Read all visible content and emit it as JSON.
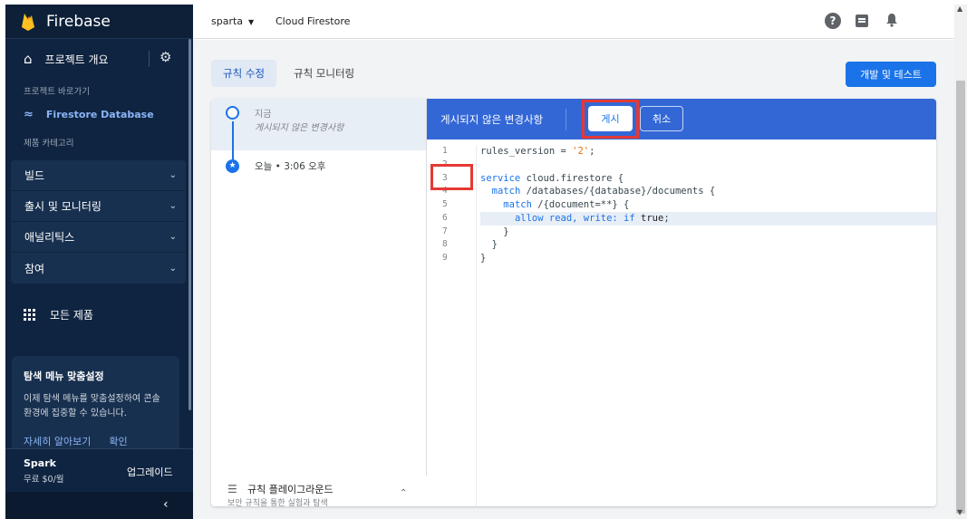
{
  "sidebar": {
    "brand": "Firebase",
    "overview_label": "프로젝트 개요",
    "shortcuts_label": "프로젝트 바로가기",
    "active_item": "Firestore Database",
    "category_label": "제품 카테고리",
    "groups": [
      {
        "label": "빌드"
      },
      {
        "label": "출시 및 모니터링"
      },
      {
        "label": "애널리틱스"
      },
      {
        "label": "참여"
      }
    ],
    "all_products": "모든 제품",
    "card": {
      "title": "탐색 메뉴 맞춤설정",
      "text": "이제 탐색 메뉴를 맞춤설정하여 콘솔 환경에 집중할 수 있습니다.",
      "learn_more": "자세히 알아보기",
      "confirm": "확인"
    },
    "plan": {
      "name": "Spark",
      "price": "무료 $0/월",
      "upgrade": "업그레이드"
    }
  },
  "topbar": {
    "project": "sparta",
    "product": "Cloud Firestore"
  },
  "tabs": [
    {
      "label": "규칙 수정",
      "active": true
    },
    {
      "label": "규칙 모니터링",
      "active": false
    }
  ],
  "dev_button": "개발 및 테스트",
  "history": {
    "now": "지금",
    "unpublished": "게시되지 않은 변경사항",
    "today": "오늘 • 3:06 오후"
  },
  "playground": {
    "title": "규칙 플레이그라운드",
    "subtitle": "보안 규칙을 통한 실험과 탐색"
  },
  "editor": {
    "unpublished_label": "게시되지 않은 변경사항",
    "publish": "게시",
    "cancel": "취소",
    "line_numbers": [
      "1",
      "2",
      "3",
      "4",
      "5",
      "6",
      "7",
      "8",
      "9"
    ]
  },
  "code": {
    "l1_a": "rules_version = ",
    "l1_str": "'2'",
    "l1_b": ";",
    "l3_kw": "service",
    "l3_b": " cloud.firestore {",
    "l4_indent": "  ",
    "l4_kw": "match",
    "l4_b": " /databases/{database}/documents {",
    "l5_indent": "    ",
    "l5_kw": "match",
    "l5_b": " /{document=**} {",
    "l6_indent": "      ",
    "l6_kw": "allow read, write: if",
    "l6_sp": " ",
    "l6_val": "true",
    "l6_b": ";",
    "l7": "    }",
    "l8": "  }",
    "l9": "}"
  },
  "icons": {
    "home": "home-icon",
    "settings": "gear-icon",
    "firestore": "firestore-icon",
    "help": "help-icon",
    "notes": "release-notes-icon",
    "notifications": "bell-icon"
  },
  "colors": {
    "accent": "#1a73e8",
    "sidebar": "#0f2440",
    "editor_header": "#3367d6",
    "highlight": "#e53935"
  }
}
